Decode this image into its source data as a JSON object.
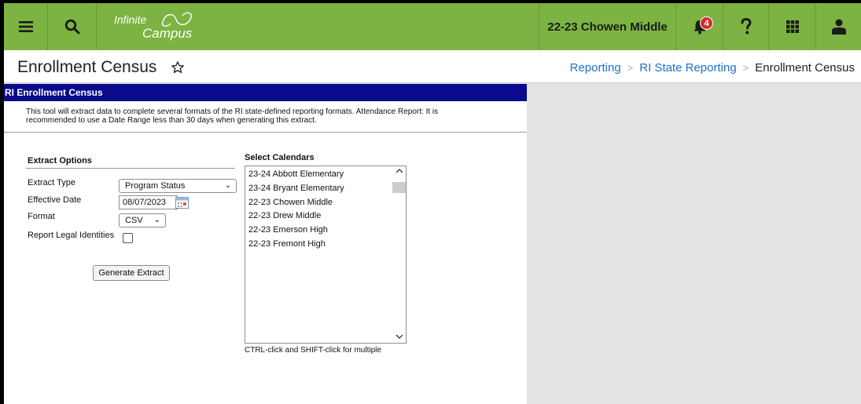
{
  "topbar": {
    "logo_line1": "Infinite",
    "logo_line2": "Campus",
    "school": "22-23 Chowen Middle",
    "notification_count": "4",
    "colors": {
      "bar": "#7cb342",
      "badge": "#d32f2f"
    },
    "icons": [
      "menu-icon",
      "search-icon",
      "bell-icon",
      "help-icon",
      "apps-grid-icon",
      "user-icon"
    ]
  },
  "page": {
    "title": "Enrollment Census",
    "breadcrumbs": [
      "Reporting",
      "RI State Reporting",
      "Enrollment Census"
    ]
  },
  "panel": {
    "header": "RI Enrollment Census",
    "header_color": "#0a0a8c",
    "description_line1": "This tool will extract data to complete several formats of the RI state-defined reporting formats. Attendance Report: It is",
    "description_line2": "recommended to use a Date Range less than 30 days when generating this extract."
  },
  "extract_options": {
    "heading": "Extract Options",
    "extract_type_label": "Extract Type",
    "extract_type_value": "Program Status",
    "effective_date_label": "Effective Date",
    "effective_date_value": "08/07/2023",
    "format_label": "Format",
    "format_value": "CSV",
    "legal_identities_label": "Report Legal Identities",
    "legal_identities_checked": false,
    "generate_button": "Generate Extract"
  },
  "calendars": {
    "heading": "Select Calendars",
    "items": [
      "23-24 Abbott Elementary",
      "23-24 Bryant Elementary",
      "22-23 Chowen Middle",
      "22-23 Drew Middle",
      "22-23 Emerson High",
      "22-23 Fremont High"
    ],
    "note": "CTRL-click and SHIFT-click for multiple"
  }
}
